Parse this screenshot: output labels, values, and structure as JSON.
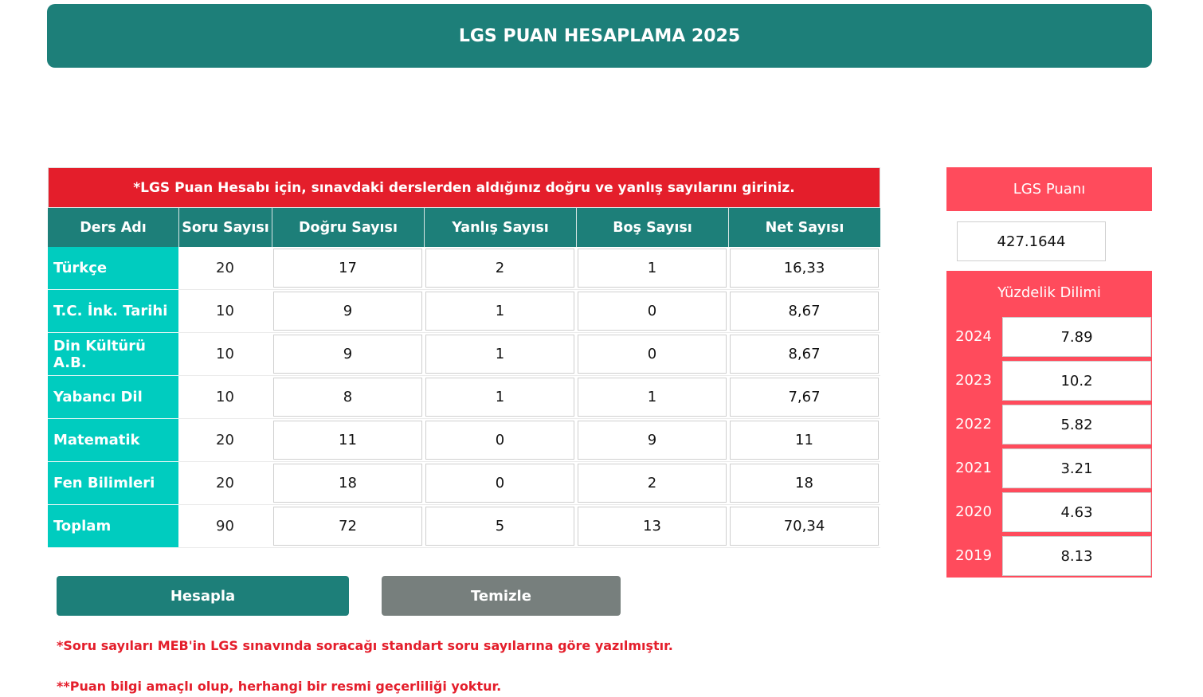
{
  "header": {
    "title": "LGS PUAN HESAPLAMA 2025"
  },
  "table": {
    "notice": "*LGS Puan Hesabı için, sınavdaki derslerden aldığınız doğru ve yanlış sayılarını giriniz.",
    "columns": [
      "Ders Adı",
      "Soru Sayısı",
      "Doğru Sayısı",
      "Yanlış Sayısı",
      "Boş Sayısı",
      "Net Sayısı"
    ],
    "rows": [
      {
        "subject": "Türkçe",
        "questions": "20",
        "correct": "17",
        "wrong": "2",
        "blank": "1",
        "net": "16,33"
      },
      {
        "subject": "T.C. İnk. Tarihi",
        "questions": "10",
        "correct": "9",
        "wrong": "1",
        "blank": "0",
        "net": "8,67"
      },
      {
        "subject": "Din Kültürü A.B.",
        "questions": "10",
        "correct": "9",
        "wrong": "1",
        "blank": "0",
        "net": "8,67"
      },
      {
        "subject": "Yabancı Dil",
        "questions": "10",
        "correct": "8",
        "wrong": "1",
        "blank": "1",
        "net": "7,67"
      },
      {
        "subject": "Matematik",
        "questions": "20",
        "correct": "11",
        "wrong": "0",
        "blank": "9",
        "net": "11"
      },
      {
        "subject": "Fen Bilimleri",
        "questions": "20",
        "correct": "18",
        "wrong": "0",
        "blank": "2",
        "net": "18"
      },
      {
        "subject": "Toplam",
        "questions": "90",
        "correct": "72",
        "wrong": "5",
        "blank": "13",
        "net": "70,34"
      }
    ]
  },
  "buttons": {
    "calculate": "Hesapla",
    "clear": "Temizle"
  },
  "notes": [
    "*Soru sayıları MEB'in LGS sınavında soracağı standart soru sayılarına göre yazılmıştır.",
    "**Puan bilgi amaçlı olup, herhangi bir resmi geçerliliği yoktur."
  ],
  "score": {
    "label": "LGS Puanı",
    "value": "427.1644"
  },
  "percentile": {
    "label": "Yüzdelik Dilimi",
    "rows": [
      {
        "year": "2024",
        "value": "7.89"
      },
      {
        "year": "2023",
        "value": "10.2"
      },
      {
        "year": "2022",
        "value": "5.82"
      },
      {
        "year": "2021",
        "value": "3.21"
      },
      {
        "year": "2020",
        "value": "4.63"
      },
      {
        "year": "2019",
        "value": "8.13"
      }
    ]
  },
  "colors": {
    "primary_teal": "#1d7f79",
    "subject_cyan": "#00ccbf",
    "notice_red": "#e41e2b",
    "score_pink": "#ff4b5c",
    "clear_gray": "#777f7d"
  }
}
